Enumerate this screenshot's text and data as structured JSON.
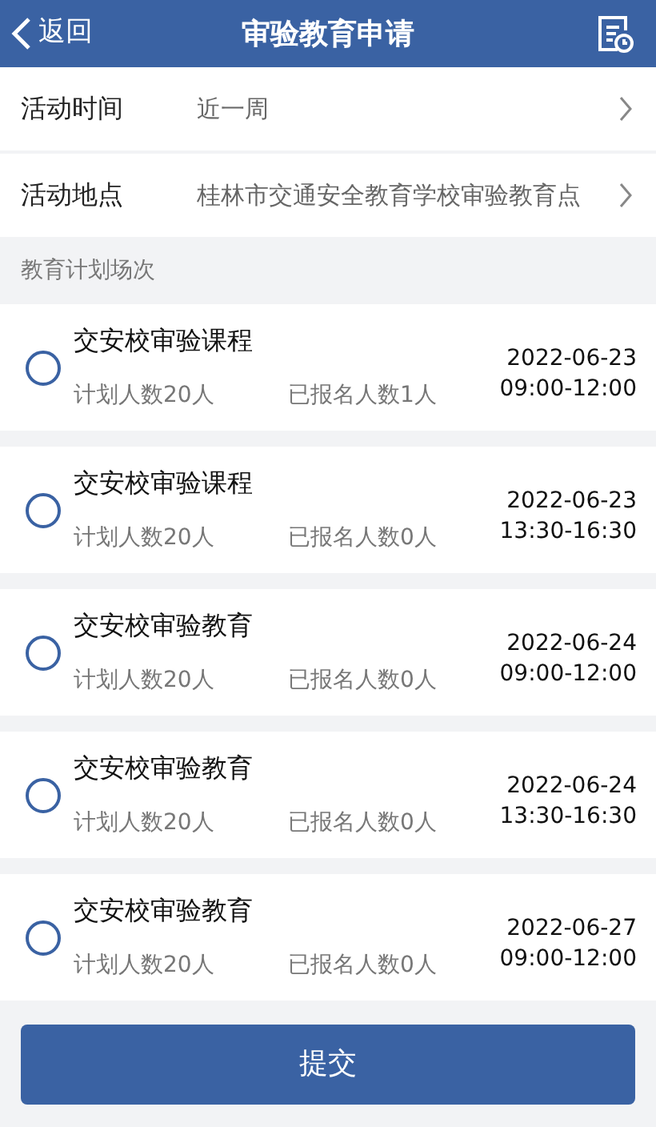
{
  "header": {
    "back": "返回",
    "title": "审验教育申请"
  },
  "filters": [
    {
      "label": "活动时间",
      "value": "近一周"
    },
    {
      "label": "活动地点",
      "value": "桂林市交通安全教育学校审验教育点"
    }
  ],
  "section_title": "教育计划场次",
  "sessions": [
    {
      "name": "交安校审验课程",
      "planned": "计划人数20人",
      "enrolled": "已报名人数1人",
      "date": "2022-06-23",
      "time": "09:00-12:00",
      "selected": false
    },
    {
      "name": "交安校审验课程",
      "planned": "计划人数20人",
      "enrolled": "已报名人数0人",
      "date": "2022-06-23",
      "time": "13:30-16:30",
      "selected": false
    },
    {
      "name": "交安校审验教育",
      "planned": "计划人数20人",
      "enrolled": "已报名人数0人",
      "date": "2022-06-24",
      "time": "09:00-12:00",
      "selected": false
    },
    {
      "name": "交安校审验教育",
      "planned": "计划人数20人",
      "enrolled": "已报名人数0人",
      "date": "2022-06-24",
      "time": "13:30-16:30",
      "selected": false
    },
    {
      "name": "交安校审验教育",
      "planned": "计划人数20人",
      "enrolled": "已报名人数0人",
      "date": "2022-06-27",
      "time": "09:00-12:00",
      "selected": false
    }
  ],
  "submit": "提交"
}
